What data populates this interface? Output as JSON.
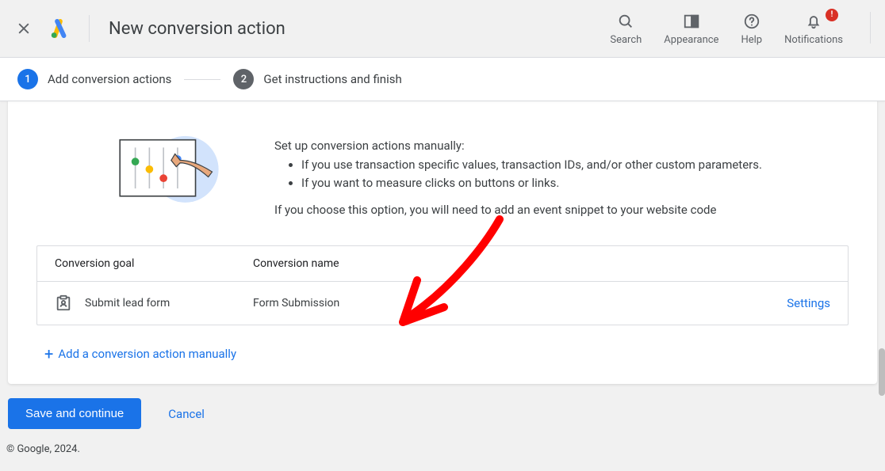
{
  "header": {
    "title": "New conversion action",
    "actions": {
      "search": "Search",
      "appearance": "Appearance",
      "help": "Help",
      "notifications": "Notifications",
      "notif_badge": "!"
    }
  },
  "stepper": {
    "step1": {
      "num": "1",
      "label": "Add conversion actions"
    },
    "step2": {
      "num": "2",
      "label": "Get instructions and finish"
    }
  },
  "intro": {
    "lead": "Set up conversion actions manually:",
    "bullet1": "If you use transaction specific values, transaction IDs, and/or other custom parameters.",
    "bullet2": "If you want to measure clicks on buttons or links.",
    "note": "If you choose this option, you will need to add an event snippet to your website code"
  },
  "table": {
    "col_goal": "Conversion goal",
    "col_name": "Conversion name",
    "row": {
      "goal": "Submit lead form",
      "name": "Form Submission",
      "settings": "Settings"
    }
  },
  "add_manual": "Add a conversion action manually",
  "buttons": {
    "save": "Save and continue",
    "cancel": "Cancel"
  },
  "footer": "© Google, 2024."
}
